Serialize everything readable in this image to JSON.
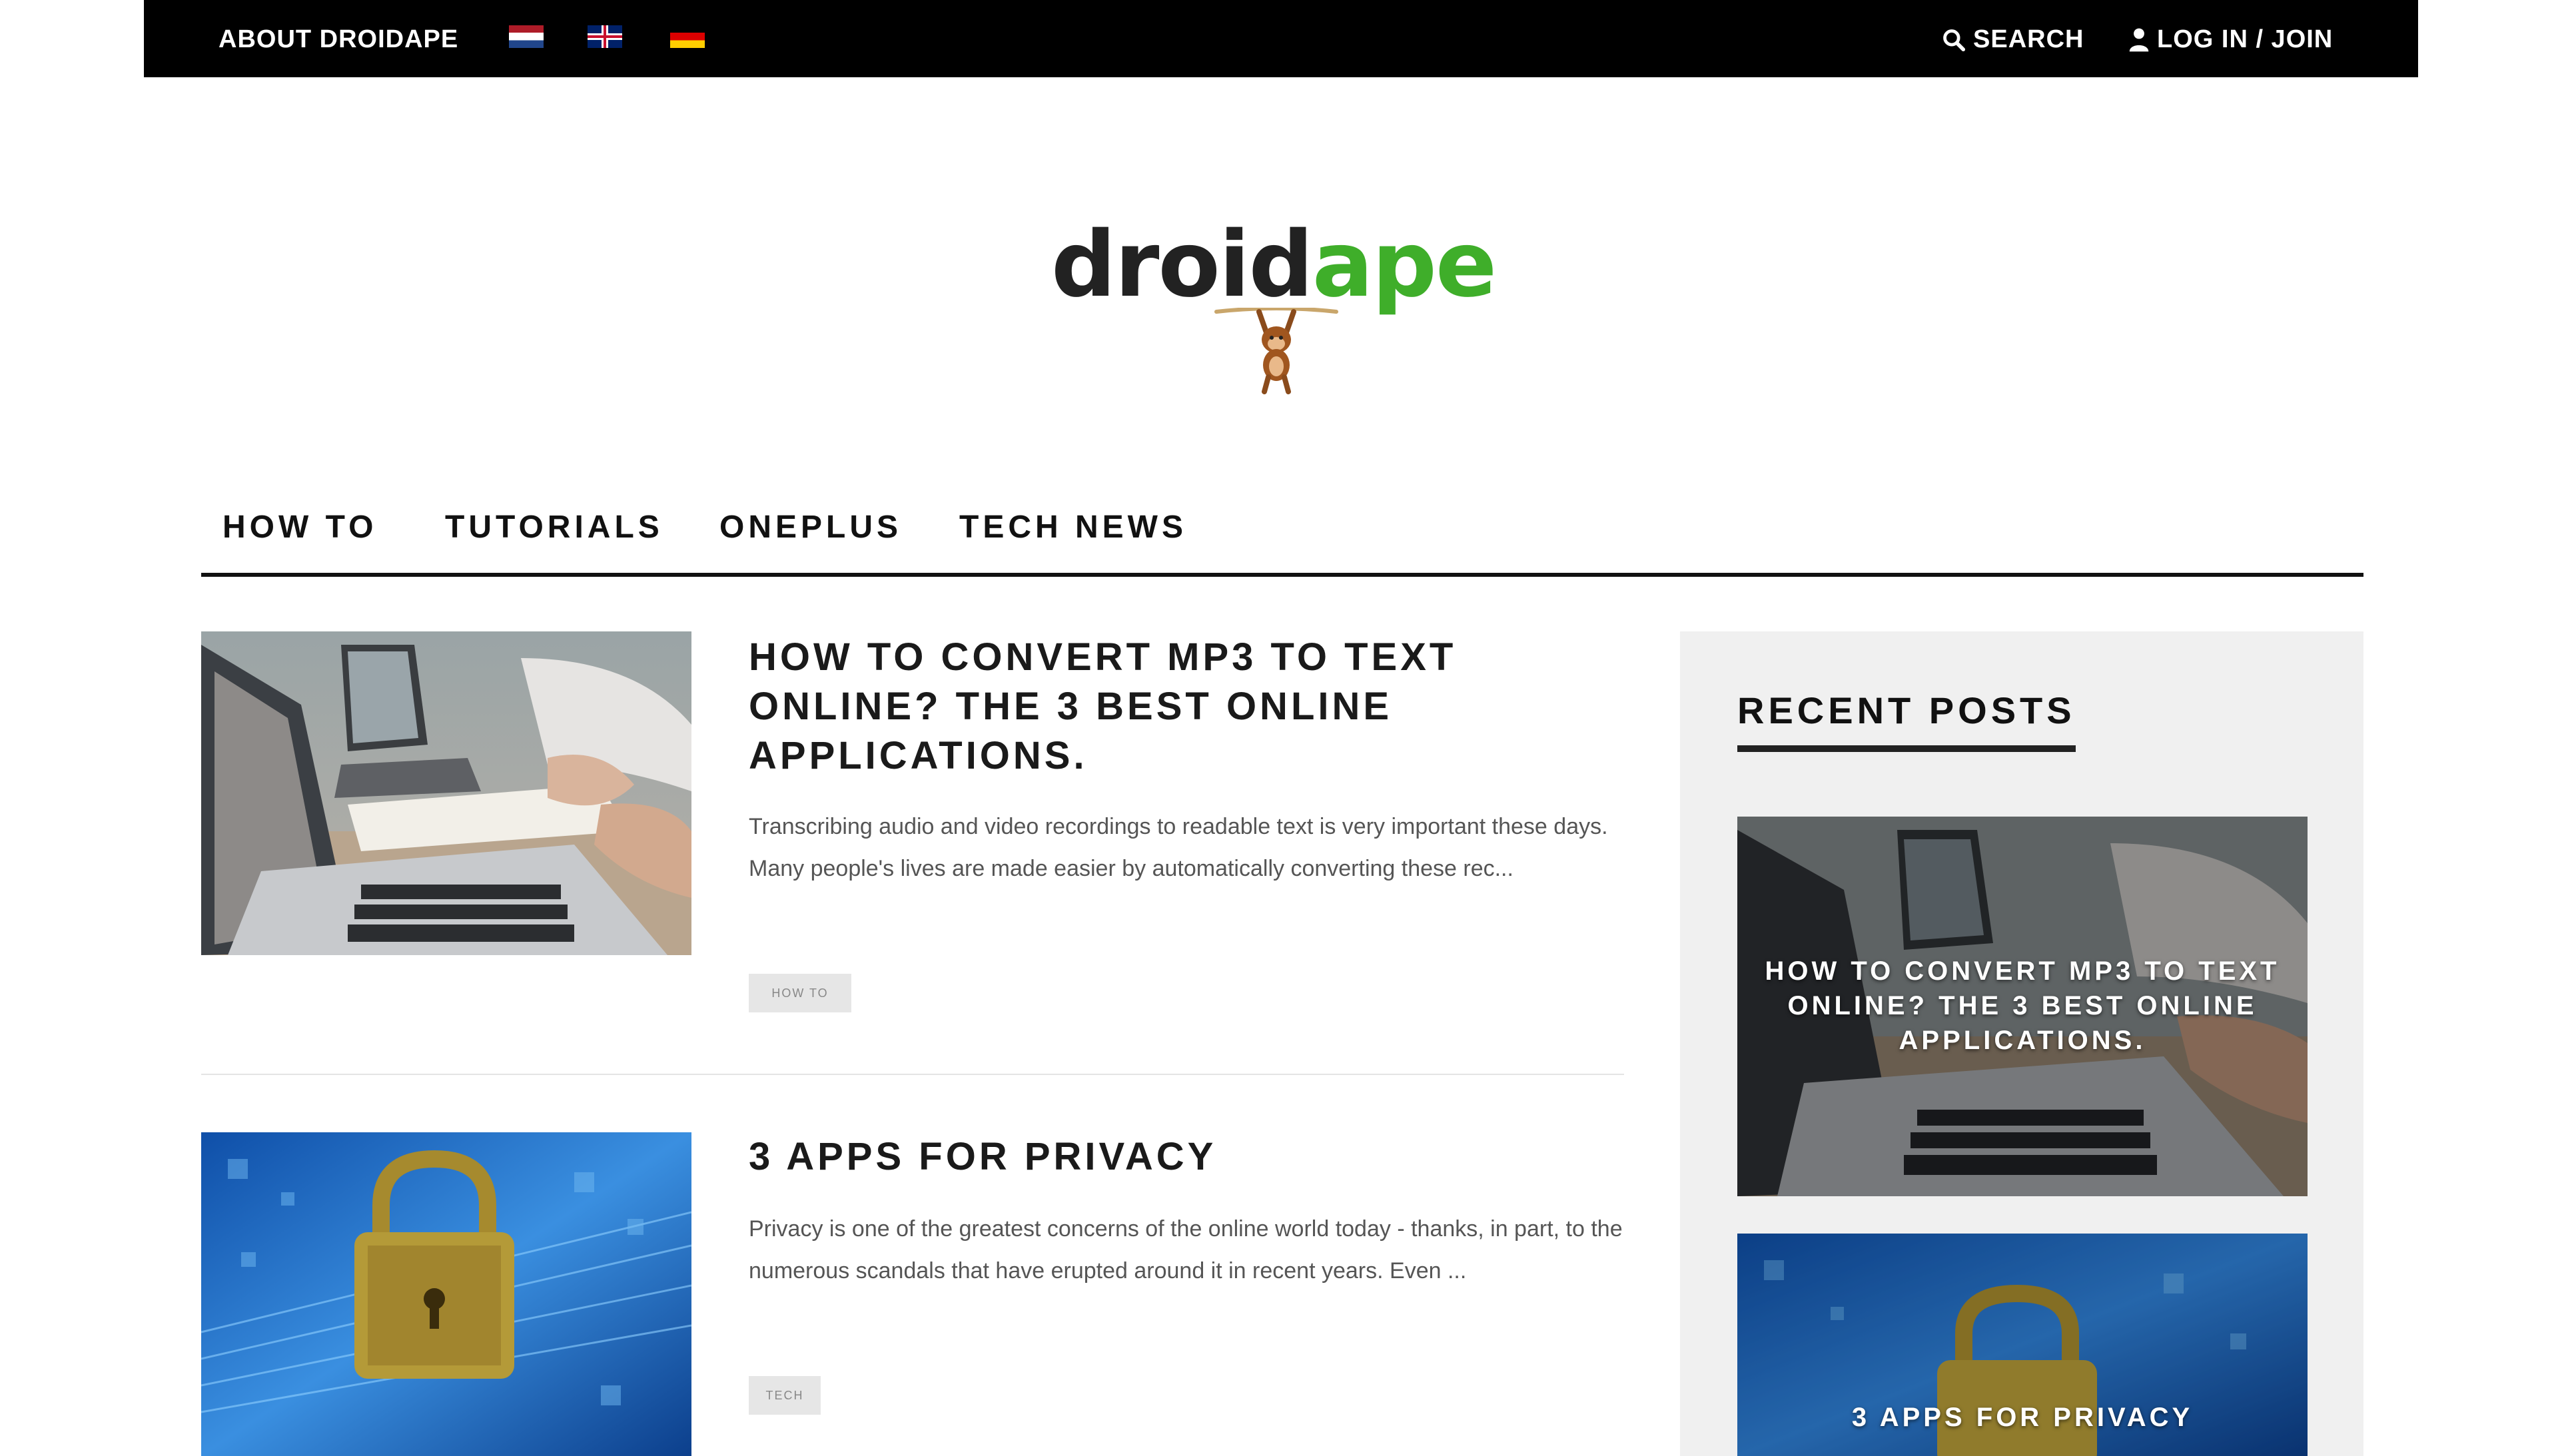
{
  "topbar": {
    "about_label": "ABOUT DROIDAPE",
    "flags": [
      "Dutch flag",
      "UK flag",
      "German flag"
    ],
    "search_label": "SEARCH",
    "login_label": "LOG IN / JOIN"
  },
  "logo": {
    "part1": "droid",
    "part2": "ape",
    "accent": "#3fae2a"
  },
  "nav": {
    "items": [
      "HOW TO",
      "TUTORIALS",
      "ONEPLUS",
      "TECH NEWS"
    ]
  },
  "posts": [
    {
      "title": "HOW TO CONVERT MP3 TO TEXT ONLINE? THE 3 BEST ONLINE APPLICATIONS.",
      "excerpt": "Transcribing audio and video recordings to readable text is very important these days. Many people's lives are made easier by automatically converting these rec...",
      "tag": "HOW TO"
    },
    {
      "title": "3 APPS FOR PRIVACY",
      "excerpt": "Privacy is one of the greatest concerns of the online world today - thanks, in part, to the numerous scandals that have erupted around it in recent years. Even ...",
      "tag": "TECH"
    }
  ],
  "sidebar": {
    "heading": "RECENT POSTS",
    "recent": [
      {
        "title": "HOW TO CONVERT MP3 TO TEXT ONLINE? THE 3 BEST ONLINE APPLICATIONS."
      },
      {
        "title": "3 APPS FOR PRIVACY"
      }
    ]
  }
}
